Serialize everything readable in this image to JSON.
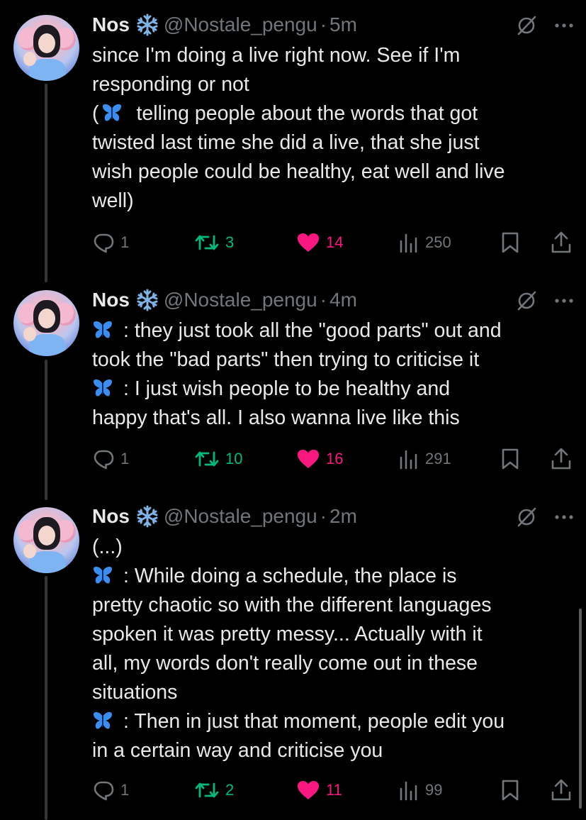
{
  "tweets": [
    {
      "name": "Nos",
      "handle": "@Nostale_pengu",
      "dot": "·",
      "time": "5m",
      "lines": [
        "since I'm doing a live right now. See if I'm",
        "responding or not",
        "telling people about the words that got",
        "twisted last time she did a live, that she just",
        "wish people could be healthy, eat well and live",
        "well)"
      ],
      "open_paren": "(",
      "replies": "1",
      "retweets": "3",
      "likes": "14",
      "views": "250"
    },
    {
      "name": "Nos",
      "handle": "@Nostale_pengu",
      "dot": "·",
      "time": "4m",
      "lines": [
        ": they just took all the \"good parts\" out and",
        "took the \"bad parts\" then trying to criticise it",
        ": I just wish people to be healthy and",
        "happy that's all. I also wanna live like this"
      ],
      "replies": "1",
      "retweets": "10",
      "likes": "16",
      "views": "291"
    },
    {
      "name": "Nos",
      "handle": "@Nostale_pengu",
      "dot": "·",
      "time": "2m",
      "lines": [
        "(...)",
        ": While doing a schedule, the place is",
        "pretty chaotic so with the different languages",
        "spoken it was pretty messy... Actually with it",
        "all, my words don't really come out in these",
        "situations",
        ": Then in just that moment, people edit you",
        "in a certain way and criticise you"
      ],
      "replies": "1",
      "retweets": "2",
      "likes": "11",
      "views": "99"
    }
  ],
  "icons": {
    "verified_emoji": "snowflake-icon",
    "inline_emoji": "butterfly-icon",
    "header": [
      "grok-icon",
      "more-icon"
    ],
    "actions": [
      "reply-icon",
      "retweet-icon",
      "like-icon",
      "views-icon",
      "bookmark-icon",
      "share-icon"
    ]
  },
  "colors": {
    "background": "#000000",
    "text": "#e7e9ea",
    "muted": "#71767b",
    "retweet": "#00ba7c",
    "like": "#f91880",
    "thread_line": "#333639",
    "butterfly": "#3b8ef0",
    "snowflake": "#7fb3e6"
  }
}
